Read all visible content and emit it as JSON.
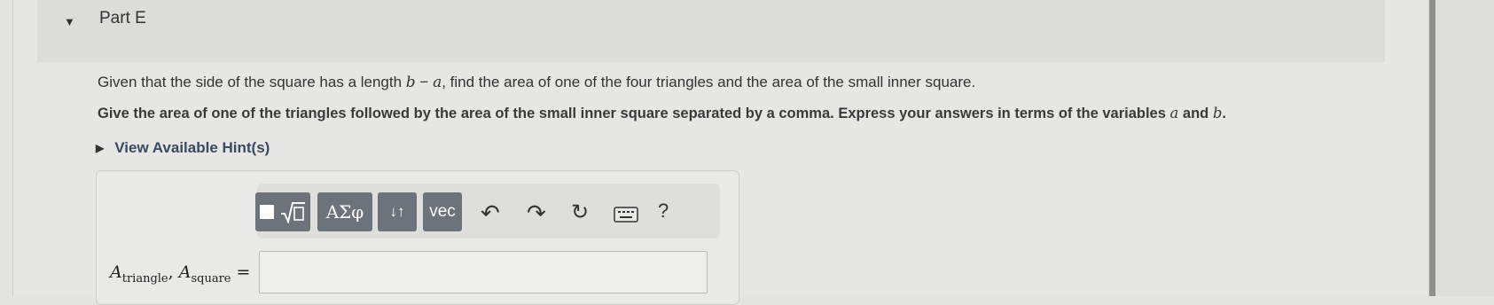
{
  "part": {
    "title": "Part E"
  },
  "prompt": {
    "before": "Given that the side of the square has a length ",
    "var_b": "b",
    "minus": " − ",
    "var_a": "a",
    "after": ", find the area of one of the four triangles and the area of the small inner square."
  },
  "instruction": {
    "before": "Give the area of one of the triangles followed by the area of the small inner square separated by a comma. Express your answers in terms of the variables ",
    "var_a": "a",
    "and": " and ",
    "var_b": "b",
    "after": "."
  },
  "hints": {
    "label": "View Available Hint(s)"
  },
  "toolbar": {
    "templates_icon": "square-root-template-icon",
    "greek_label": "ΑΣφ",
    "arrows_label": "↓↑",
    "vec_label": "vec",
    "undo_icon": "undo-icon",
    "redo_icon": "redo-icon",
    "reset_icon": "reset-icon",
    "keyboard_icon": "keyboard-icon",
    "help_label": "?"
  },
  "answer": {
    "label_A1": "A",
    "label_sub1": "triangle",
    "label_sep": ", ",
    "label_A2": "A",
    "label_sub2": "square",
    "label_eq": " =",
    "value": ""
  }
}
